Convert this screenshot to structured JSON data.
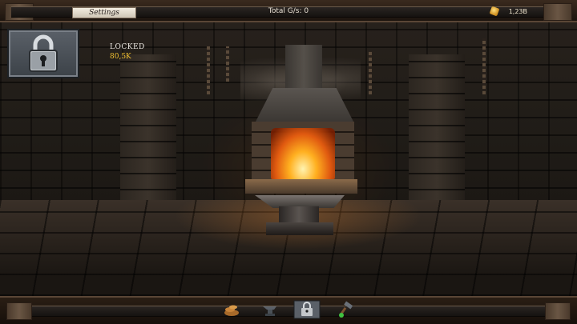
{
  "topbar": {
    "settings_label": "Settings",
    "total_gs": "Total G/s: 0",
    "currency_amount": "1,23B"
  },
  "upgrade_slot": {
    "status": "LOCKED",
    "cost": "80,5K"
  },
  "bottom_tabs": [
    {
      "name": "forge-tab",
      "icon": "bread-pile-icon"
    },
    {
      "name": "anvil-tab",
      "icon": "anvil-icon"
    },
    {
      "name": "lock-tab",
      "icon": "padlock-icon"
    },
    {
      "name": "tools-tab",
      "icon": "hammer-icon"
    }
  ],
  "colors": {
    "gold": "#f0c030",
    "fire": "#ffb020"
  }
}
